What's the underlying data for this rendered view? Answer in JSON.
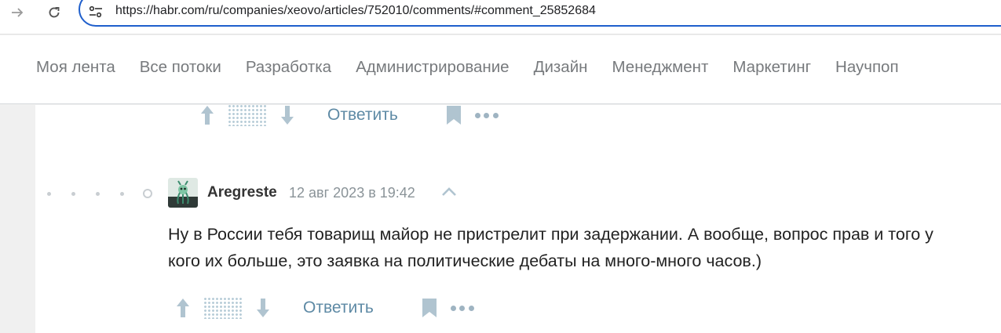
{
  "browser": {
    "url": "https://habr.com/ru/companies/xeovo/articles/752010/comments/#comment_25852684",
    "forward_icon": "arrow-right-icon",
    "reload_icon": "reload-icon",
    "site_info_icon": "tune-icon"
  },
  "topnav": {
    "items": [
      {
        "label": "Моя лента"
      },
      {
        "label": "Все потоки"
      },
      {
        "label": "Разработка"
      },
      {
        "label": "Администрирование"
      },
      {
        "label": "Дизайн"
      },
      {
        "label": "Менеджмент"
      },
      {
        "label": "Маркетинг"
      },
      {
        "label": "Научпоп"
      }
    ]
  },
  "prev_comment": {
    "actions": {
      "reply_label": "Ответить"
    }
  },
  "comment": {
    "author": "Aregreste",
    "date": "12 авг 2023 в 19:42",
    "text": "Ну в России тебя товарищ майор не пристрелит при задержании. А вообще, вопрос прав и того у кого их больше, это заявка на политические дебаты на много-много часов.)",
    "actions": {
      "reply_label": "Ответить"
    }
  },
  "colors": {
    "accent": "#5e8aa5",
    "icon": "#b0c4d0",
    "omnibox_border": "#1f5fcc"
  }
}
